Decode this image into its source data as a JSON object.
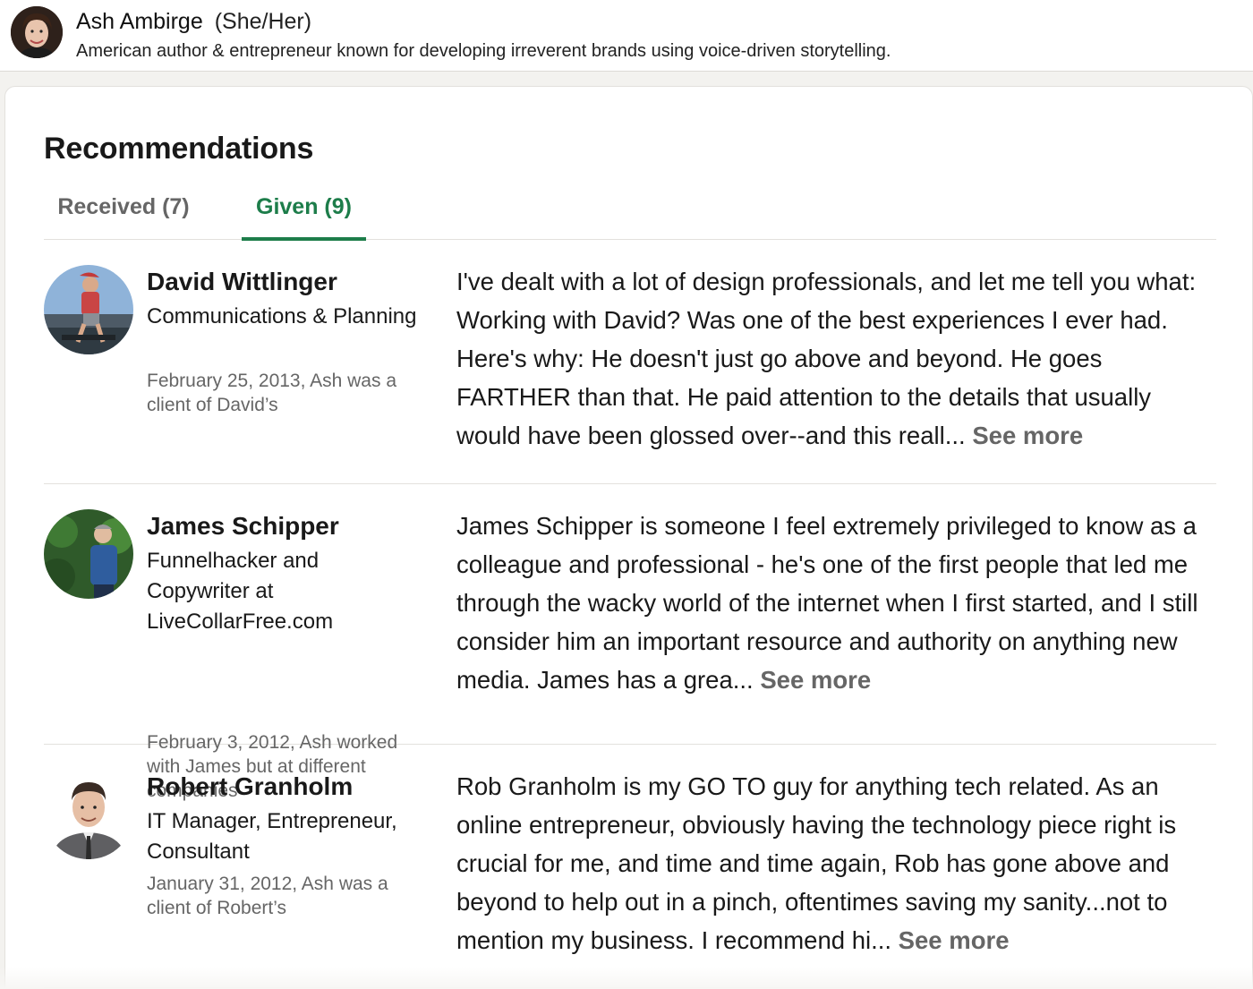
{
  "profile": {
    "name": "Ash Ambirge",
    "pronouns": "(She/Her)",
    "headline": "American author & entrepreneur known for developing irreverent brands using voice-driven storytelling."
  },
  "section": {
    "title": "Recommendations",
    "tabs": [
      {
        "label": "Received (7)",
        "active": false
      },
      {
        "label": "Given (9)",
        "active": true
      }
    ]
  },
  "colors": {
    "accent": "#1d7d4a",
    "muted_text": "#666666",
    "divider": "#e3e1dd"
  },
  "recommendations": [
    {
      "name": "David Wittlinger",
      "headline": "Communications & Planning",
      "meta": "February 25, 2013, Ash was a client of David’s",
      "text": "I've dealt with a lot of design professionals, and let me tell you what: Working with David? Was one of the best experiences I ever had. Here's why: He doesn't just go above and beyond. He goes FARTHER than that. He paid attention to the details that usually would have been glossed over--and this reall...",
      "see_more": "See more"
    },
    {
      "name": "James Schipper",
      "headline": "Funnelhacker and Copywriter at LiveCollarFree.com",
      "meta": "February 3, 2012, Ash worked with James but at different companies",
      "text": "James Schipper is someone I feel extremely privileged to know as a colleague and professional - he's one of the first people that led me through the wacky world of the internet when I first started, and I still consider him an important resource and authority on anything new media. James has a grea...",
      "see_more": "See more"
    },
    {
      "name": "Robert Granholm",
      "headline": "IT Manager, Entrepreneur, Consultant",
      "meta": "January 31, 2012, Ash was a client of Robert’s",
      "text": "Rob Granholm is my GO TO guy for anything tech related. As an online entrepreneur, obviously having the technology piece right is crucial for me, and time and time again, Rob has gone above and beyond to help out in a pinch, oftentimes saving my sanity...not to mention my business. I recommend hi...",
      "see_more": "See more"
    }
  ]
}
